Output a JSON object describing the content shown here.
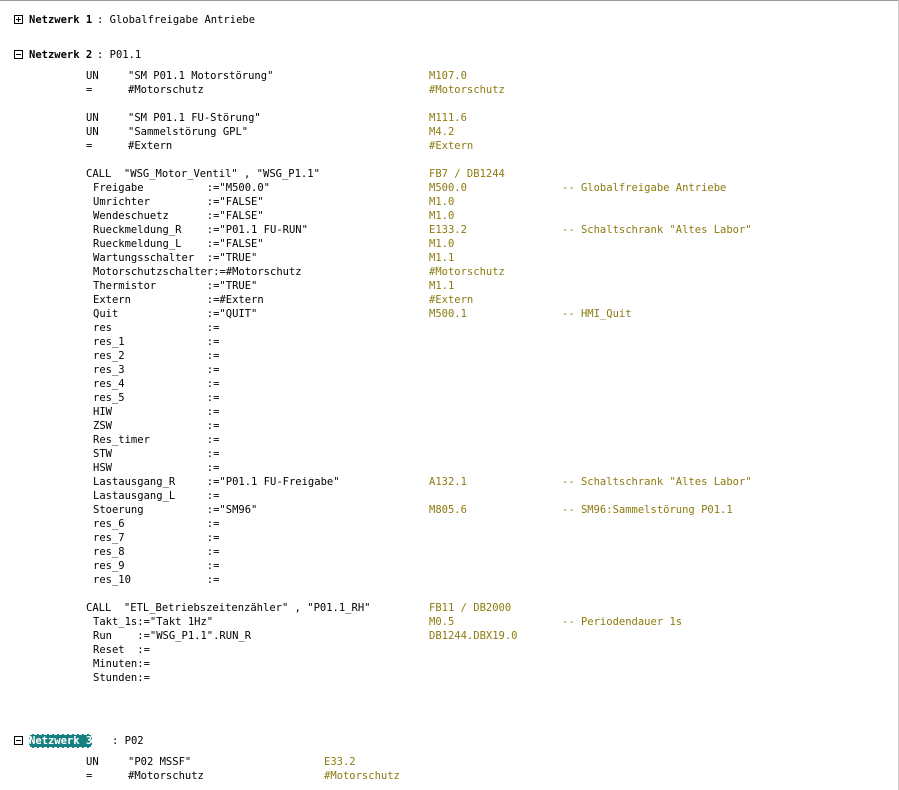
{
  "networks": [
    {
      "toggle": "+",
      "word": "Netzwerk 1",
      "title": ": Globalfreigabe Antriebe"
    },
    {
      "toggle": "-",
      "word": "Netzwerk 2",
      "title": ": P01.1"
    },
    {
      "toggle": "-",
      "word": "Netzwerk 3",
      "title": ": P02"
    }
  ],
  "net2": {
    "block1": [
      {
        "op": "UN",
        "arg": "\"SM P01.1 Motorstörung\"",
        "addr": "M107.0"
      },
      {
        "op": "=",
        "arg": "#Motorschutz",
        "addr": "#Motorschutz"
      }
    ],
    "block2": [
      {
        "op": "UN",
        "arg": "\"SM P01.1 FU-Störung\"",
        "addr": "M111.6"
      },
      {
        "op": "UN",
        "arg": "\"Sammelstörung GPL\"",
        "addr": "M4.2"
      },
      {
        "op": "=",
        "arg": "#Extern",
        "addr": "#Extern"
      }
    ],
    "call1": {
      "text": "CALL  \"WSG_Motor_Ventil\" , \"WSG_P1.1\"",
      "addr": "FB7 / DB1244",
      "params": [
        {
          "text": "Freigabe          :=\"M500.0\"",
          "addr": "M500.0",
          "cmt": "-- Globalfreigabe Antriebe"
        },
        {
          "text": "Umrichter         :=\"FALSE\"",
          "addr": "M1.0",
          "cmt": ""
        },
        {
          "text": "Wendeschuetz      :=\"FALSE\"",
          "addr": "M1.0",
          "cmt": ""
        },
        {
          "text": "Rueckmeldung_R    :=\"P01.1 FU-RUN\"",
          "addr": "E133.2",
          "cmt": "-- Schaltschrank \"Altes Labor\""
        },
        {
          "text": "Rueckmeldung_L    :=\"FALSE\"",
          "addr": "M1.0",
          "cmt": ""
        },
        {
          "text": "Wartungsschalter  :=\"TRUE\"",
          "addr": "M1.1",
          "cmt": ""
        },
        {
          "text": "Motorschutzschalter:=#Motorschutz",
          "addr": "#Motorschutz",
          "cmt": ""
        },
        {
          "text": "Thermistor        :=\"TRUE\"",
          "addr": "M1.1",
          "cmt": ""
        },
        {
          "text": "Extern            :=#Extern",
          "addr": "#Extern",
          "cmt": ""
        },
        {
          "text": "Quit              :=\"QUIT\"",
          "addr": "M500.1",
          "cmt": "-- HMI_Quit"
        },
        {
          "text": "res               :=",
          "addr": "",
          "cmt": ""
        },
        {
          "text": "res_1             :=",
          "addr": "",
          "cmt": ""
        },
        {
          "text": "res_2             :=",
          "addr": "",
          "cmt": ""
        },
        {
          "text": "res_3             :=",
          "addr": "",
          "cmt": ""
        },
        {
          "text": "res_4             :=",
          "addr": "",
          "cmt": ""
        },
        {
          "text": "res_5             :=",
          "addr": "",
          "cmt": ""
        },
        {
          "text": "HIW               :=",
          "addr": "",
          "cmt": ""
        },
        {
          "text": "ZSW               :=",
          "addr": "",
          "cmt": ""
        },
        {
          "text": "Res_timer         :=",
          "addr": "",
          "cmt": ""
        },
        {
          "text": "STW               :=",
          "addr": "",
          "cmt": ""
        },
        {
          "text": "HSW               :=",
          "addr": "",
          "cmt": ""
        },
        {
          "text": "Lastausgang_R     :=\"P01.1 FU-Freigabe\"",
          "addr": "A132.1",
          "cmt": "-- Schaltschrank \"Altes Labor\""
        },
        {
          "text": "Lastausgang_L     :=",
          "addr": "",
          "cmt": ""
        },
        {
          "text": "Stoerung          :=\"SM96\"",
          "addr": "M805.6",
          "cmt": "-- SM96:Sammelstörung P01.1"
        },
        {
          "text": "res_6             :=",
          "addr": "",
          "cmt": ""
        },
        {
          "text": "res_7             :=",
          "addr": "",
          "cmt": ""
        },
        {
          "text": "res_8             :=",
          "addr": "",
          "cmt": ""
        },
        {
          "text": "res_9             :=",
          "addr": "",
          "cmt": ""
        },
        {
          "text": "res_10            :=",
          "addr": "",
          "cmt": ""
        }
      ]
    },
    "call2": {
      "text": "CALL  \"ETL_Betriebszeitenzähler\" , \"P01.1_RH\"",
      "addr": "FB11 / DB2000",
      "params": [
        {
          "text": "Takt_1s:=\"Takt 1Hz\"",
          "addr": "M0.5",
          "cmt": "-- Periodendauer 1s"
        },
        {
          "text": "Run    :=\"WSG_P1.1\".RUN_R",
          "addr": "DB1244.DBX19.0",
          "cmt": ""
        },
        {
          "text": "Reset  :=",
          "addr": "",
          "cmt": ""
        },
        {
          "text": "Minuten:=",
          "addr": "",
          "cmt": ""
        },
        {
          "text": "Stunden:=",
          "addr": "",
          "cmt": ""
        }
      ]
    }
  },
  "net3": {
    "block1": [
      {
        "op": "UN",
        "arg": "\"P02 MSSF\"",
        "addr": "E33.2"
      },
      {
        "op": "=",
        "arg": "#Motorschutz",
        "addr": "#Motorschutz"
      }
    ]
  }
}
